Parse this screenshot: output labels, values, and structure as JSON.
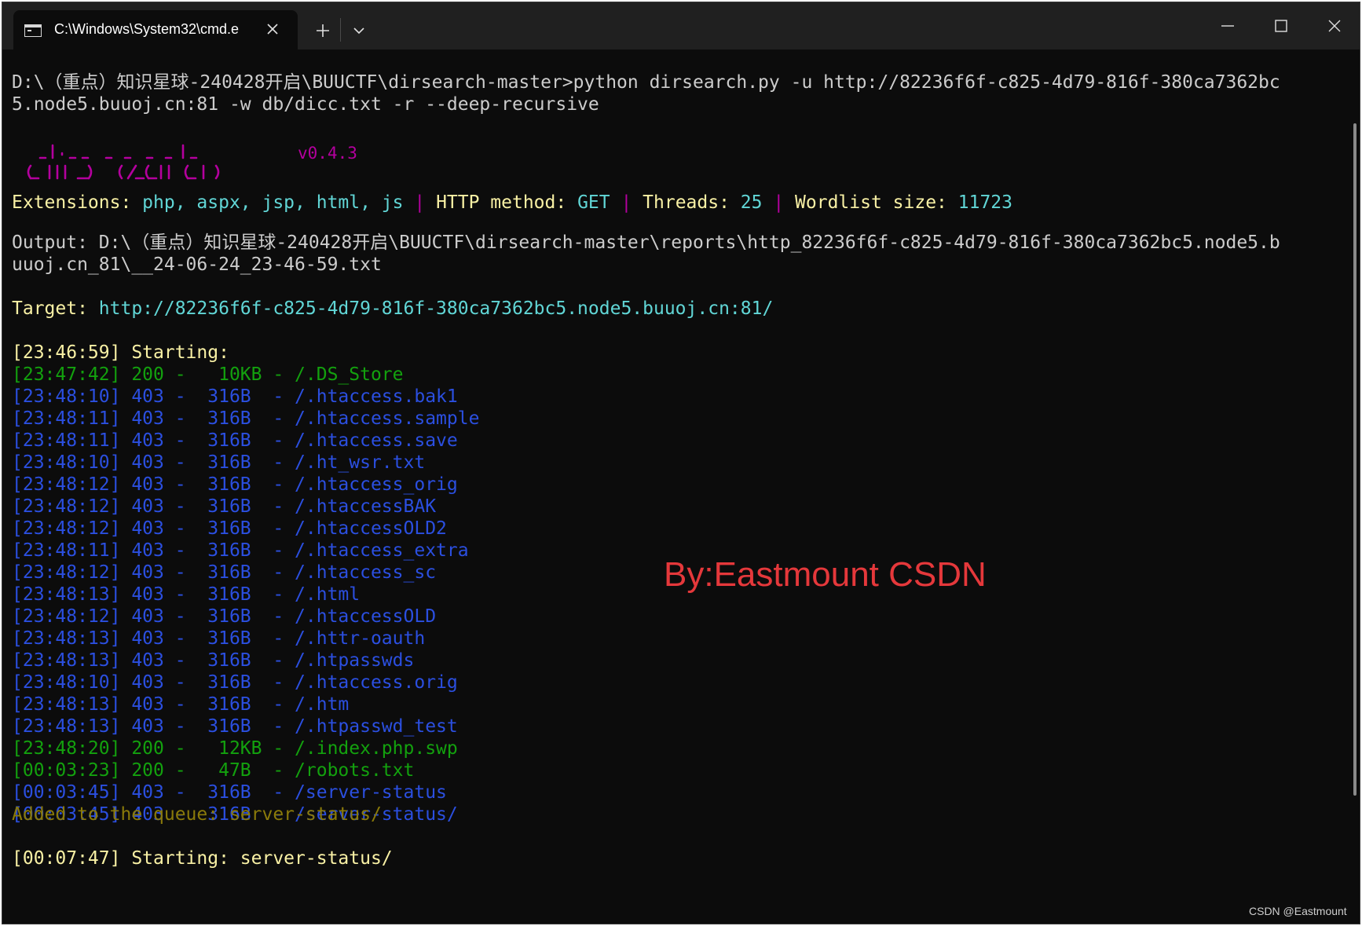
{
  "window": {
    "tab_title": "C:\\Windows\\System32\\cmd.e",
    "tab_icon": "terminal-icon",
    "controls": [
      "minimize-icon",
      "maximize-icon",
      "close-icon"
    ]
  },
  "colors": {
    "background": "#0c0c0c",
    "default_text": "#cccccc",
    "yellow": "#f9f1a5",
    "cyan": "#61d6d6",
    "magenta": "#b4009e",
    "green": "#13a10e",
    "blue": "#2b4fe0",
    "olive": "#8a7a0a",
    "watermark": "#e5383b"
  },
  "terminal": {
    "command_line_1": "D:\\（重点）知识星球-240428开启\\BUUCTF\\dirsearch-master>python dirsearch.py -u http://82236f6f-c825-4d79-816f-380ca7362bc",
    "command_line_2": "5.node5.buuoj.cn:81 -w db/dicc.txt -r --deep-recursive",
    "version": "v0.4.3",
    "config": {
      "ext_label": "Extensions: ",
      "ext_value": "php, aspx, jsp, html, js",
      "sep": " | ",
      "method_label": "HTTP method: ",
      "method_value": "GET",
      "threads_label": "Threads: ",
      "threads_value": "25",
      "wordlist_label": "Wordlist size: ",
      "wordlist_value": "11723"
    },
    "output_line_1": "Output: D:\\（重点）知识星球-240428开启\\BUUCTF\\dirsearch-master\\reports\\http_82236f6f-c825-4d79-816f-380ca7362bc5.node5.b",
    "output_line_2": "uuoj.cn_81\\__24-06-24_23-46-59.txt",
    "target_label": "Target: ",
    "target_url": "http://82236f6f-c825-4d79-816f-380ca7362bc5.node5.buuoj.cn:81/",
    "start_1": "[23:46:59] Starting:",
    "results": [
      {
        "text": "[23:47:42] 200 -   10KB - /.DS_Store",
        "color": "green"
      },
      {
        "text": "[23:48:10] 403 -  316B  - /.htaccess.bak1",
        "color": "blue"
      },
      {
        "text": "[23:48:11] 403 -  316B  - /.htaccess.sample",
        "color": "blue"
      },
      {
        "text": "[23:48:11] 403 -  316B  - /.htaccess.save",
        "color": "blue"
      },
      {
        "text": "[23:48:10] 403 -  316B  - /.ht_wsr.txt",
        "color": "blue"
      },
      {
        "text": "[23:48:12] 403 -  316B  - /.htaccess_orig",
        "color": "blue"
      },
      {
        "text": "[23:48:12] 403 -  316B  - /.htaccessBAK",
        "color": "blue"
      },
      {
        "text": "[23:48:12] 403 -  316B  - /.htaccessOLD2",
        "color": "blue"
      },
      {
        "text": "[23:48:11] 403 -  316B  - /.htaccess_extra",
        "color": "blue"
      },
      {
        "text": "[23:48:12] 403 -  316B  - /.htaccess_sc",
        "color": "blue"
      },
      {
        "text": "[23:48:13] 403 -  316B  - /.html",
        "color": "blue"
      },
      {
        "text": "[23:48:12] 403 -  316B  - /.htaccessOLD",
        "color": "blue"
      },
      {
        "text": "[23:48:13] 403 -  316B  - /.httr-oauth",
        "color": "blue"
      },
      {
        "text": "[23:48:13] 403 -  316B  - /.htpasswds",
        "color": "blue"
      },
      {
        "text": "[23:48:10] 403 -  316B  - /.htaccess.orig",
        "color": "blue"
      },
      {
        "text": "[23:48:13] 403 -  316B  - /.htm",
        "color": "blue"
      },
      {
        "text": "[23:48:13] 403 -  316B  - /.htpasswd_test",
        "color": "blue"
      },
      {
        "text": "[23:48:20] 200 -   12KB - /.index.php.swp",
        "color": "green"
      },
      {
        "text": "[00:03:23] 200 -   47B  - /robots.txt",
        "color": "green"
      },
      {
        "text": "[00:03:45] 403 -  316B  - /server-status",
        "color": "blue"
      },
      {
        "text": "[00:03:45] 403 -  316B  - /server-status/",
        "color": "blue"
      }
    ],
    "queue_line": "Added to the queue: server-status/",
    "start_2": "[00:07:47] Starting: server-status/"
  },
  "watermark": "By:Eastmount CSDN",
  "credit": "CSDN @Eastmount"
}
